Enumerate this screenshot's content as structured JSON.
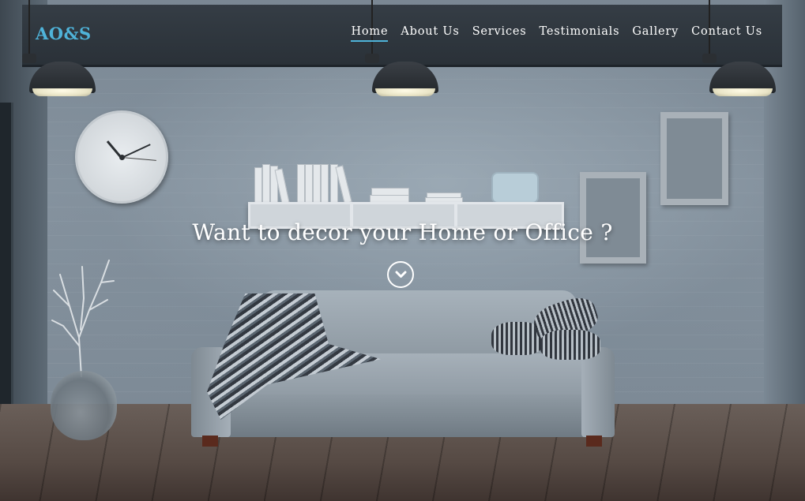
{
  "brand": {
    "logo": "AO&S",
    "accent_color": "#4fb3d9"
  },
  "nav": {
    "items": [
      {
        "label": "Home",
        "active": true
      },
      {
        "label": "About Us",
        "active": false
      },
      {
        "label": "Services",
        "active": false
      },
      {
        "label": "Testimonials",
        "active": false
      },
      {
        "label": "Gallery",
        "active": false
      },
      {
        "label": "Contact Us",
        "active": false
      }
    ]
  },
  "hero": {
    "headline": "Want to decor your Home or Office ?",
    "scroll_icon": "chevron-down-icon",
    "text_color": "#ffffff"
  }
}
